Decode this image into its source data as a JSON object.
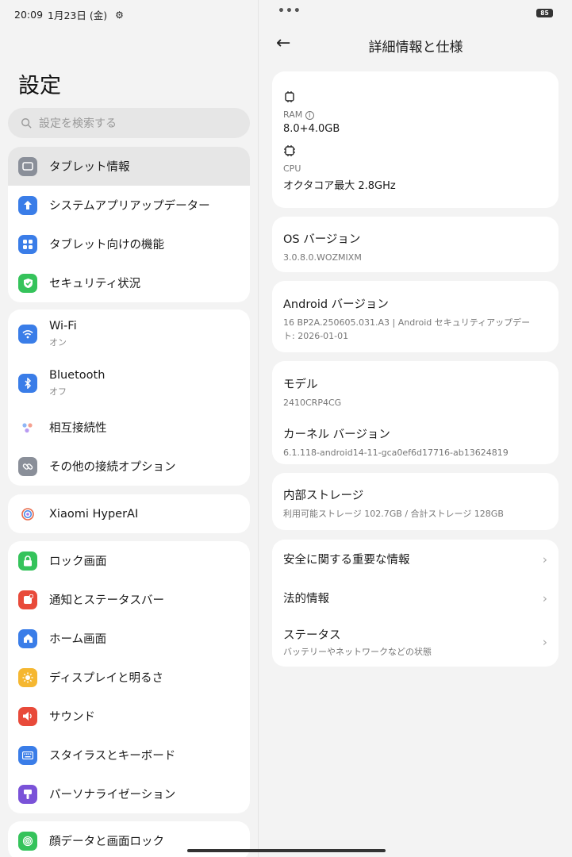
{
  "status": {
    "time": "20:09",
    "date": "1月23日 (金)",
    "battery": "85"
  },
  "left": {
    "title": "設定",
    "search_placeholder": "設定を検索する",
    "groups": [
      [
        {
          "label": "タブレット情報",
          "icon": "tablet-icon",
          "color": "#8a8f99",
          "selected": true
        },
        {
          "label": "システムアプリアップデーター",
          "icon": "arrow-up-icon",
          "color": "#3a7de8"
        },
        {
          "label": "タブレット向けの機能",
          "icon": "grid-icon",
          "color": "#3a7de8"
        },
        {
          "label": "セキュリティ状況",
          "icon": "shield-check-icon",
          "color": "#35c35b"
        }
      ],
      [
        {
          "label": "Wi-Fi",
          "sub": "オン",
          "icon": "wifi-icon",
          "color": "#3a7de8"
        },
        {
          "label": "Bluetooth",
          "sub": "オフ",
          "icon": "bluetooth-icon",
          "color": "#3a7de8"
        },
        {
          "label": "相互接続性",
          "icon": "dots-icon",
          "color": "#ffffff"
        },
        {
          "label": "その他の接続オプション",
          "icon": "link-icon",
          "color": "#8a8f99"
        }
      ],
      [
        {
          "label": "Xiaomi HyperAI",
          "icon": "hyperai-icon",
          "color": "#ffffff"
        }
      ],
      [
        {
          "label": "ロック画面",
          "icon": "lock-icon",
          "color": "#35c35b"
        },
        {
          "label": "通知とステータスバー",
          "icon": "notification-icon",
          "color": "#e84a3a"
        },
        {
          "label": "ホーム画面",
          "icon": "home-icon",
          "color": "#3a7de8"
        },
        {
          "label": "ディスプレイと明るさ",
          "icon": "sun-icon",
          "color": "#f5b731"
        },
        {
          "label": "サウンド",
          "icon": "speaker-icon",
          "color": "#e84a3a"
        },
        {
          "label": "スタイラスとキーボード",
          "icon": "keyboard-icon",
          "color": "#3a7de8"
        },
        {
          "label": "パーソナライゼーション",
          "icon": "brush-icon",
          "color": "#7a52d8"
        }
      ],
      [
        {
          "label": "顔データと画面ロック",
          "icon": "fingerprint-icon",
          "color": "#35c35b"
        }
      ]
    ]
  },
  "right": {
    "title": "詳細情報と仕様",
    "specs": {
      "ram_label": "RAM",
      "ram_value": "8.0+4.0GB",
      "cpu_label": "CPU",
      "cpu_value": "オクタコア最大 2.8GHz"
    },
    "os": {
      "title": "OS バージョン",
      "value": "3.0.8.0.WOZMIXM"
    },
    "android": {
      "title": "Android バージョン",
      "value": "16 BP2A.250605.031.A3 | Android セキュリティアップデート: 2026-01-01"
    },
    "model": {
      "title": "モデル",
      "value": "2410CRP4CG"
    },
    "kernel": {
      "title": "カーネル バージョン",
      "value": "6.1.118-android14-11-gca0ef6d17716-ab13624819"
    },
    "storage": {
      "title": "内部ストレージ",
      "value": "利用可能ストレージ  102.7GB / 合計ストレージ  128GB"
    },
    "links": [
      {
        "title": "安全に関する重要な情報"
      },
      {
        "title": "法的情報"
      },
      {
        "title": "ステータス",
        "sub": "バッテリーやネットワークなどの状態"
      }
    ]
  }
}
